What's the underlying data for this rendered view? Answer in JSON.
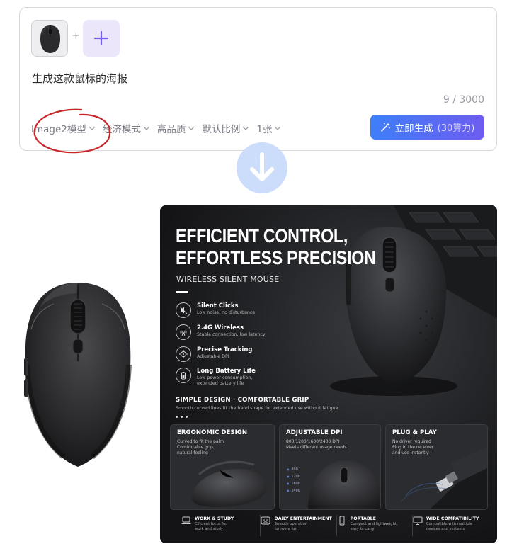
{
  "prompt_card": {
    "prompt_text": "生成这款鼠标的海报",
    "char_counter": "9 / 3000",
    "plus_separator": "+",
    "options": [
      {
        "label": "Image2模型"
      },
      {
        "label": "经济模式"
      },
      {
        "label": "高品质"
      },
      {
        "label": "默认比例"
      },
      {
        "label": "1张"
      }
    ],
    "generate_button": {
      "label": "立即生成",
      "cost": "(30算力)"
    }
  },
  "poster": {
    "headline_line1": "EFFICIENT CONTROL,",
    "headline_line2": "EFFORTLESS PRECISION",
    "subheadline": "WIRELESS SILENT MOUSE",
    "features": [
      {
        "title": "Silent Clicks",
        "desc1": "Low noise, no disturbance",
        "desc2": "",
        "icon": "mute-icon"
      },
      {
        "title": "2.4G Wireless",
        "desc1": "Stable connection, low latency",
        "desc2": "",
        "icon": "wireless-icon"
      },
      {
        "title": "Precise Tracking",
        "desc1": "Adjustable DPI",
        "desc2": "",
        "icon": "crosshair-icon"
      },
      {
        "title": "Long Battery Life",
        "desc1": "Low power consumption,",
        "desc2": "extended battery life",
        "icon": "battery-icon"
      }
    ],
    "design_title": "SIMPLE DESIGN · COMFORTABLE GRIP",
    "design_desc": "Smooth curved lines fit the hand shape for extended use without fatigue",
    "panels": [
      {
        "title": "ERGONOMIC DESIGN",
        "lines": [
          "Curved to fit the palm",
          "Comfortable grip,",
          "natural feeling"
        ]
      },
      {
        "title": "ADJUSTABLE DPI",
        "lines": [
          "800/1200/1600/2400 DPI",
          "Meets different usage needs"
        ],
        "dpi_levels": [
          "800",
          "1200",
          "1600",
          "2400"
        ]
      },
      {
        "title": "PLUG & PLAY",
        "lines": [
          "No driver required",
          "Plug in the receiver",
          "and use instantly"
        ]
      }
    ],
    "bottom_features": [
      {
        "title": "WORK & STUDY",
        "desc1": "Efficient focus for",
        "desc2": "work and study",
        "icon": "laptop-icon"
      },
      {
        "title": "DAILY ENTERTAINMENT",
        "desc1": "Smooth operation",
        "desc2": "for more fun",
        "icon": "gamepad-icon"
      },
      {
        "title": "PORTABLE",
        "desc1": "Compact and lightweight,",
        "desc2": "easy to carry",
        "icon": "phone-icon"
      },
      {
        "title": "WIDE COMPATIBILITY",
        "desc1": "Compatible with multiple",
        "desc2": "devices and systems",
        "icon": "monitor-icon"
      }
    ]
  },
  "colors": {
    "accent_purple": "#7b5cf0",
    "button_gradient_start": "#3f7ef8",
    "button_gradient_end": "#6d5cf0",
    "annotation_red": "#c8262a",
    "arrow_circle": "#ccdcfb",
    "poster_bg": "#1b1c1e"
  }
}
